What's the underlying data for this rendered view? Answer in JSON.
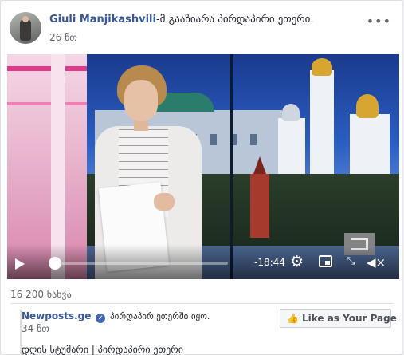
{
  "post": {
    "author": "Giuli Manjikashvili",
    "action": "-მ გააზიარა პირდაპირი ეთერი.",
    "time": "26 წთ",
    "more_glyph": "•••"
  },
  "video": {
    "remaining_time": "-18:44",
    "progress": 0.0,
    "icons": [
      "play-icon",
      "gear-icon",
      "pip-icon",
      "expand-icon",
      "volume-mute-icon"
    ]
  },
  "stats": {
    "views": "16 200 ნახვა"
  },
  "shared_page": {
    "name": "Newposts.ge",
    "action": "პირდაპირ ეთერში იყო.",
    "time": "34 წთ",
    "like_button": "Like as Your Page",
    "description": "დღის სტუმარი | პირდაპირი ეთერი"
  },
  "colors": {
    "link": "#385898",
    "secondary_text": "#616770",
    "verified": "#4267b2"
  }
}
